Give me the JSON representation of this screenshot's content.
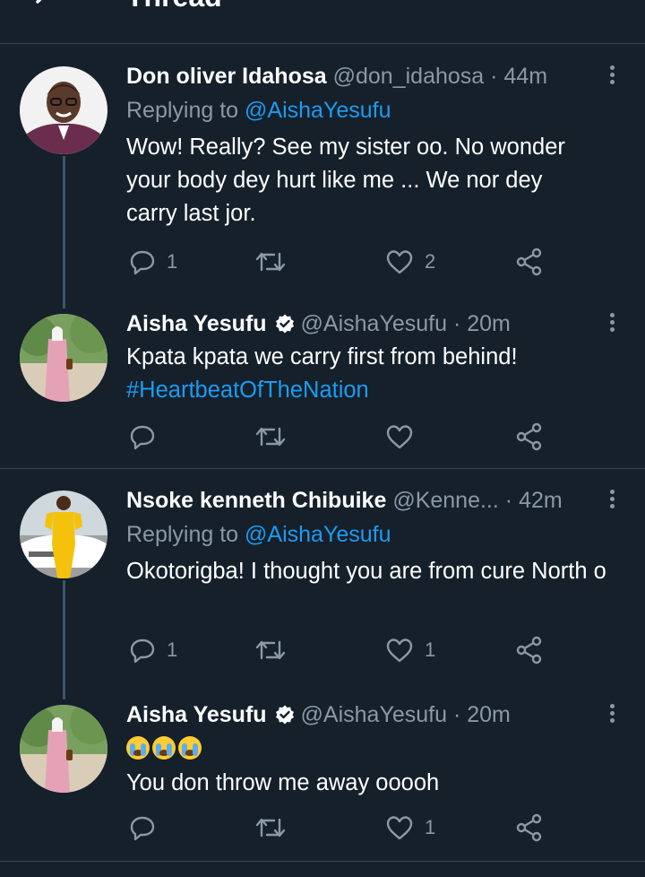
{
  "header": {
    "title": "Thread"
  },
  "tweets": [
    {
      "name": "Don oliver Idahosa",
      "handle": "@don_idahosa",
      "sep": "·",
      "time": "44m",
      "replying_label": "Replying to",
      "replying_handle": "@AishaYesufu",
      "text": "Wow! Really? See my sister oo. No wonder your body dey hurt like me ... We nor dey carry last jor.",
      "replies": "1",
      "retweets": "",
      "likes": "2"
    },
    {
      "name": "Aisha Yesufu",
      "verified": true,
      "handle": "@AishaYesufu",
      "sep": "·",
      "time": "20m",
      "text": "Kpata kpata we carry first from behind!",
      "hashtag": "#HeartbeatOfTheNation",
      "replies": "",
      "retweets": "",
      "likes": ""
    },
    {
      "name": "Nsoke kenneth Chibuike",
      "handle": "@Kenne...",
      "sep": "·",
      "time": "42m",
      "replying_label": "Replying to",
      "replying_handle": "@AishaYesufu",
      "text": "Okotorigba! I thought you are from cure North o",
      "replies": "1",
      "retweets": "",
      "likes": "1"
    },
    {
      "name": "Aisha Yesufu",
      "verified": true,
      "handle": "@AishaYesufu",
      "sep": "·",
      "time": "20m",
      "emojis": [
        "loudly-crying-face",
        "loudly-crying-face",
        "loudly-crying-face"
      ],
      "text": "You don throw me away ooooh",
      "replies": "",
      "retweets": "",
      "likes": "1"
    }
  ],
  "colors": {
    "background": "#15202b",
    "border": "#38444d",
    "secondary_text": "#8b98a5",
    "accent": "#1d9bf0"
  }
}
